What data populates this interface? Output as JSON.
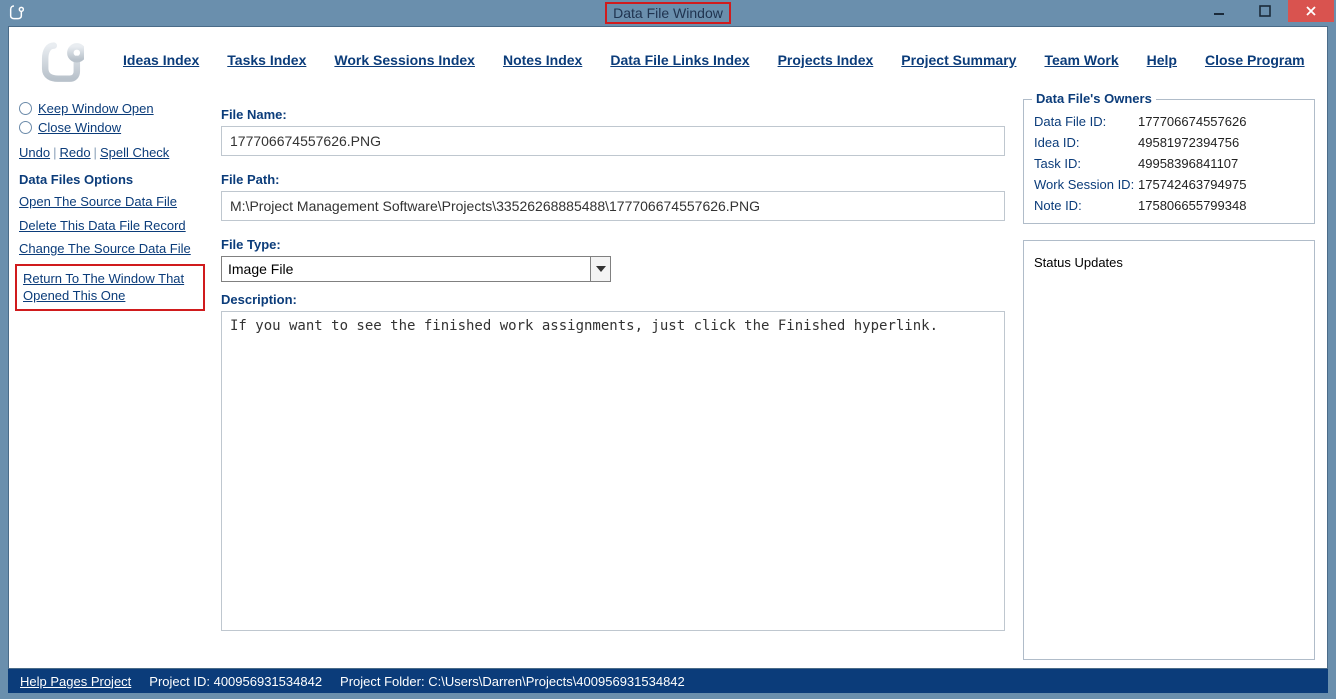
{
  "window": {
    "title": "Data File Window"
  },
  "menu": {
    "ideas": "Ideas Index",
    "tasks": "Tasks Index",
    "work_sessions": "Work Sessions Index",
    "notes": "Notes Index",
    "datafile_links": "Data File Links Index",
    "projects": "Projects Index",
    "project_summary": "Project Summary",
    "team_work": "Team Work",
    "help": "Help",
    "close_program": "Close Program"
  },
  "sidebar": {
    "radio_keep": "Keep Window Open",
    "radio_close": "Close Window",
    "undo": "Undo",
    "redo": "Redo",
    "spell": "Spell Check",
    "options_header": "Data Files Options",
    "open_source": "Open The Source Data File",
    "delete_record": "Delete This Data File Record",
    "change_source": "Change The Source Data File",
    "return_window": "Return To The Window That Opened This One"
  },
  "form": {
    "file_name_label": "File Name:",
    "file_name_value": "177706674557626.PNG",
    "file_path_label": "File Path:",
    "file_path_value": "M:\\Project Management Software\\Projects\\33526268885488\\177706674557626.PNG",
    "file_type_label": "File Type:",
    "file_type_value": "Image File",
    "description_label": "Description:",
    "description_value": "If you want to see the finished work assignments, just click the Finished hyperlink."
  },
  "owners": {
    "legend": "Data File's Owners",
    "data_file_id_label": "Data File ID:",
    "data_file_id_value": "177706674557626",
    "idea_id_label": "Idea ID:",
    "idea_id_value": "49581972394756",
    "task_id_label": "Task ID:",
    "task_id_value": "49958396841107",
    "work_session_id_label": "Work Session ID:",
    "work_session_id_value": "175742463794975",
    "note_id_label": "Note ID:",
    "note_id_value": "175806655799348"
  },
  "status_updates": {
    "legend": "Status Updates"
  },
  "footer": {
    "help_pages": "Help Pages Project",
    "project_id_label": "Project ID:",
    "project_id_value": "400956931534842",
    "project_folder_label": "Project Folder:",
    "project_folder_value": "C:\\Users\\Darren\\Projects\\400956931534842"
  }
}
